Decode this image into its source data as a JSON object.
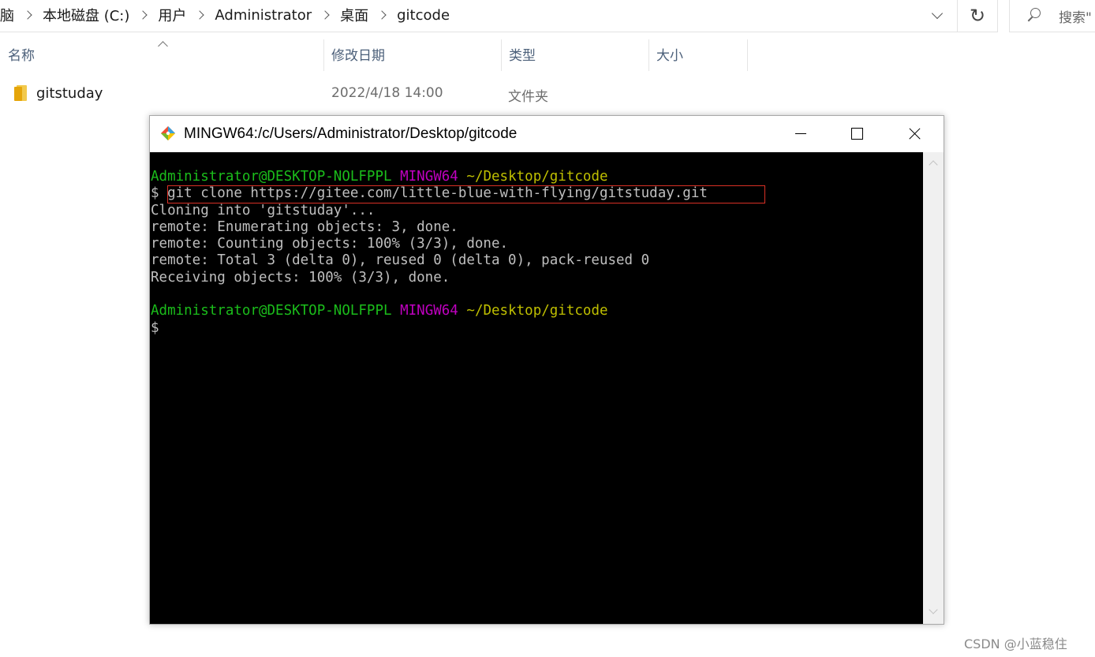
{
  "breadcrumb": {
    "items": [
      "脑",
      "本地磁盘 (C:)",
      "用户",
      "Administrator",
      "桌面",
      "gitcode"
    ]
  },
  "search": {
    "placeholder": "搜索\""
  },
  "columns": {
    "name": "名称",
    "date": "修改日期",
    "type": "类型",
    "size": "大小"
  },
  "files": [
    {
      "name": "gitstuday",
      "date": "2022/4/18 14:00",
      "type": "文件夹",
      "icon": "folder-icon"
    }
  ],
  "terminal_window": {
    "title": "MINGW64:/c/Users/Administrator/Desktop/gitcode",
    "prompt1": {
      "user": "Administrator@DESKTOP-NOLFPPL",
      "env": "MINGW64",
      "path": "~/Desktop/gitcode"
    },
    "command": "$ git clone https://gitee.com/little-blue-with-flying/gitstuday.git",
    "output": [
      "Cloning into 'gitstuday'...",
      "remote: Enumerating objects: 3, done.",
      "remote: Counting objects: 100% (3/3), done.",
      "remote: Total 3 (delta 0), reused 0 (delta 0), pack-reused 0",
      "Receiving objects: 100% (3/3), done."
    ],
    "prompt2": {
      "user": "Administrator@DESKTOP-NOLFPPL",
      "env": "MINGW64",
      "path": "~/Desktop/gitcode"
    },
    "cursor_line": "$"
  },
  "watermark": "CSDN @小蓝稳住",
  "colors": {
    "prompt_user": "#1bbd1b",
    "prompt_env": "#bf00bf",
    "prompt_path": "#bfbf00",
    "terminal_text": "#bfbfbf",
    "highlight_box": "#d93025"
  }
}
